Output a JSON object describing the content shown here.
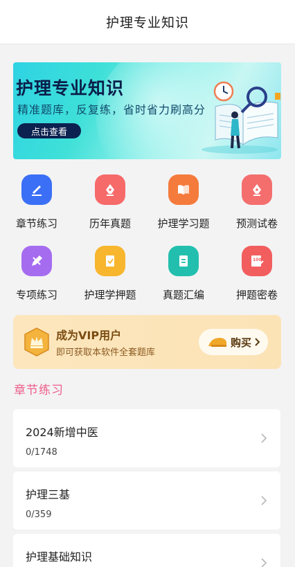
{
  "header": {
    "title": "护理专业知识"
  },
  "banner": {
    "title": "护理专业知识",
    "subtitle": "精准题库，反复练，省时省力刷高分",
    "button_label": "点击查看"
  },
  "grid": {
    "items": [
      {
        "label": "章节练习",
        "icon": "pen-icon",
        "color": "#3b6ff5"
      },
      {
        "label": "历年真题",
        "icon": "pen-nib-icon",
        "color": "#f66a6a"
      },
      {
        "label": "护理学习题",
        "icon": "book-icon",
        "color": "#f57b3c"
      },
      {
        "label": "预测试卷",
        "icon": "pen-nib-icon",
        "color": "#f46e6e"
      },
      {
        "label": "专项练习",
        "icon": "pencil-icon",
        "color": "#a56cf0"
      },
      {
        "label": "护理学押题",
        "icon": "paper-icon",
        "color": "#f7b62e"
      },
      {
        "label": "真题汇编",
        "icon": "document-icon",
        "color": "#23bfae"
      },
      {
        "label": "押题密卷",
        "icon": "exam-100-icon",
        "color": "#f25e5e"
      }
    ]
  },
  "vip": {
    "title": "成为VIP用户",
    "subtitle": "即可获取本软件全套题库",
    "button_label": "购买"
  },
  "section": {
    "title": "章节练习"
  },
  "chapters": [
    {
      "name": "2024新增中医",
      "progress": "0/1748"
    },
    {
      "name": "护理三基",
      "progress": "0/359"
    },
    {
      "name": "护理基础知识",
      "progress": ""
    }
  ],
  "colors": {
    "accent_pink": "#ee5d8a",
    "vip_bg": "#fde6bd"
  }
}
